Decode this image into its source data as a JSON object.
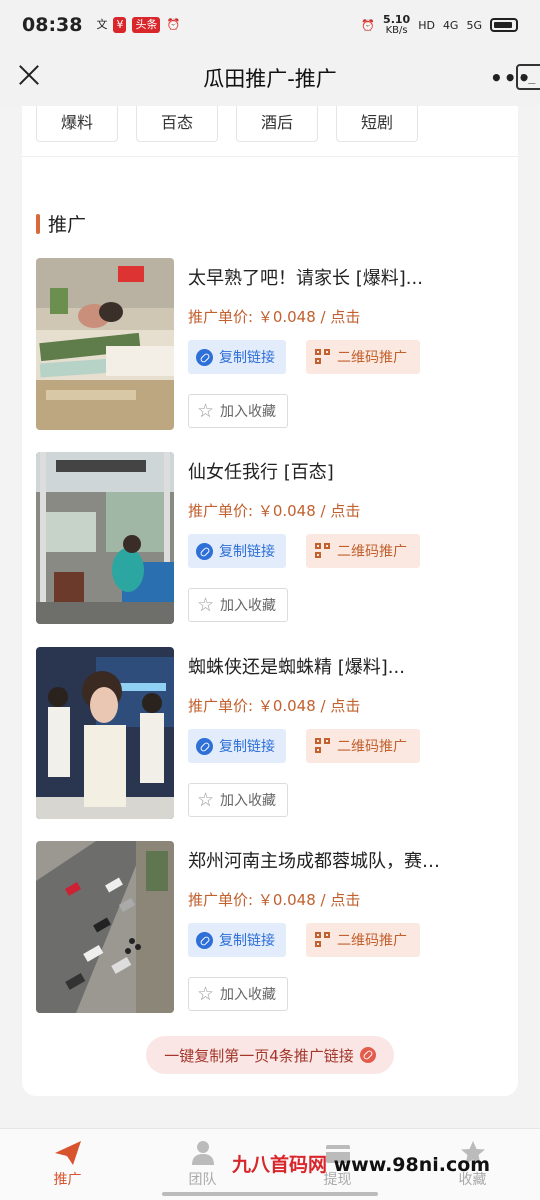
{
  "status_bar": {
    "time": "08:38",
    "left_icons": [
      "文",
      "¥",
      "头条",
      "⏰"
    ],
    "net_speed_value": "5.10",
    "net_speed_unit": "KB/s",
    "hd": "HD",
    "sig1": "4G",
    "sig2": "5G"
  },
  "nav": {
    "title": "瓜田推广-推广",
    "more": "•••"
  },
  "categories": [
    "爆料",
    "百态",
    "酒后",
    "短剧"
  ],
  "section": {
    "title": "推广"
  },
  "items": [
    {
      "title": "太早熟了吧！请家长 [爆料]...",
      "price": "推广单价: ￥0.048 / 点击",
      "copy_label": "复制链接",
      "qr_label": "二维码推广",
      "fav_label": "加入收藏"
    },
    {
      "title": "仙女任我行 [百态]",
      "price": "推广单价: ￥0.048 / 点击",
      "copy_label": "复制链接",
      "qr_label": "二维码推广",
      "fav_label": "加入收藏"
    },
    {
      "title": "蜘蛛侠还是蜘蛛精 [爆料]...",
      "price": "推广单价: ￥0.048 / 点击",
      "copy_label": "复制链接",
      "qr_label": "二维码推广",
      "fav_label": "加入收藏"
    },
    {
      "title": "郑州河南主场成都蓉城队，赛…",
      "price": "推广单价: ￥0.048 / 点击",
      "copy_label": "复制链接",
      "qr_label": "二维码推广",
      "fav_label": "加入收藏"
    }
  ],
  "copy_all_label": "一键复制第一页4条推广链接",
  "tabs": [
    {
      "label": "推广",
      "icon": "paper-plane-icon",
      "active": true
    },
    {
      "label": "团队",
      "icon": "team-icon",
      "active": false
    },
    {
      "label": "提现",
      "icon": "withdraw-icon",
      "active": false
    },
    {
      "label": "收藏",
      "icon": "star-icon",
      "active": false
    }
  ],
  "watermark": {
    "part1": "九八首码网",
    "part2": " www.98ni.com"
  },
  "colors": {
    "accent": "#d8542f",
    "price": "#c2602e",
    "link_blue": "#2e6fd8"
  }
}
